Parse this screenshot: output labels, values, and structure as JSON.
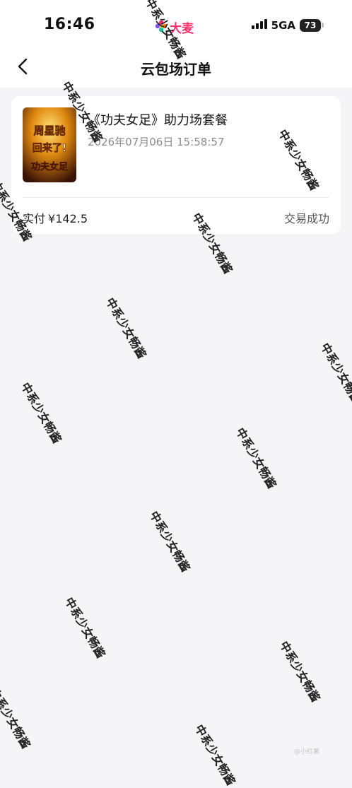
{
  "status_bar": {
    "time": "16:46",
    "app_name": "大麦",
    "network": "5GA",
    "battery": "73"
  },
  "nav": {
    "title": "云包场订单"
  },
  "order": {
    "title": "《功夫女足》助力场套餐",
    "datetime": "2026年07月06日 15:58:57",
    "payment_label": "实付",
    "amount": "¥142.5",
    "status": "交易成功",
    "poster_text_line1": "周星驰",
    "poster_text_line2": "回来了!",
    "poster_text_line3": "功夫女足"
  },
  "watermark": {
    "text": "中系少女畅酱"
  },
  "footer": {
    "signature": "@小红薯"
  },
  "colors": {
    "brand": "#ff2d6b",
    "background": "#f5f5f8",
    "card": "#ffffff",
    "secondary_text": "#8c8c8c"
  }
}
